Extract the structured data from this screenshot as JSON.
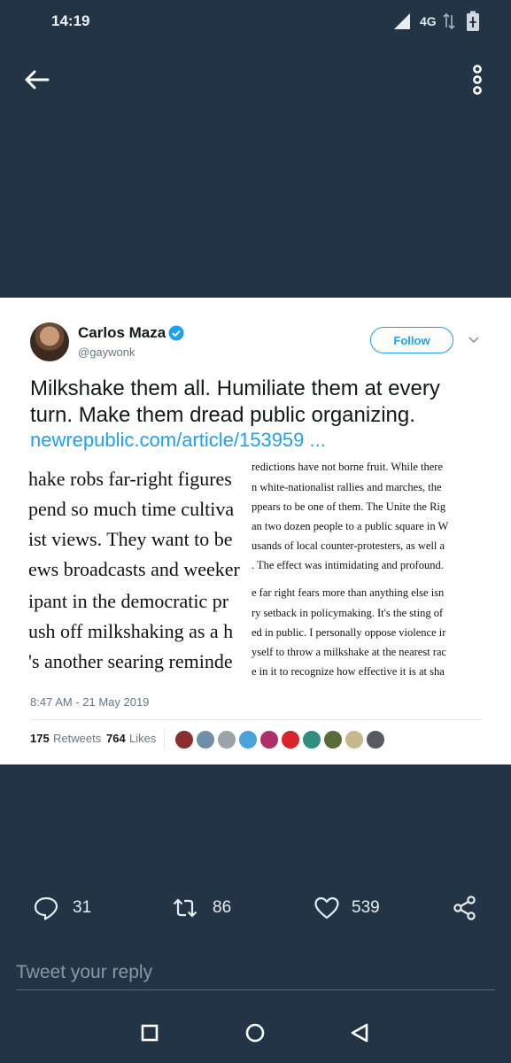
{
  "status_bar": {
    "time": "14:19",
    "network": "4G",
    "icons": [
      "signal-icon",
      "data-arrows-icon",
      "battery-charging-icon"
    ]
  },
  "top_bar": {
    "back_icon": "back-arrow-icon",
    "menu_icon": "overflow-menu-icon"
  },
  "embedded_tweet": {
    "display_name": "Carlos Maza",
    "handle": "@gaywonk",
    "follow_label": "Follow",
    "text_lines": [
      "Milkshake them all. Humiliate them at every",
      "turn. Make them dread public organizing."
    ],
    "link": "newrepublic.com/article/153959 ...",
    "article": {
      "left_lines": [
        "hake robs far-right figures",
        "pend so much time cultiva",
        "ist views. They want to be",
        "ews broadcasts and weeker",
        "ipant in the democratic pr",
        "ush off milkshaking as a h",
        "'s another searing reminde"
      ],
      "right_lines": [
        "redictions have not borne fruit. While there",
        "n white-nationalist rallies and marches, the",
        "ppears to be one of them. The Unite the Rig",
        "an two dozen people to a public square in W",
        "usands of local counter-protesters, as well a",
        ". The effect was intimidating and profound.",
        "e far right fears more than anything else isn",
        "ry setback in policymaking. It's the sting of",
        "ed in public. I personally oppose violence ir",
        "yself to throw a milkshake at the nearest rac",
        "e in it to recognize how effective it is at sha"
      ]
    },
    "timestamp": "8:47 AM - 21 May 2019",
    "retweets_count": "175",
    "retweets_label": "Retweets",
    "likes_count": "764",
    "likes_label": "Likes",
    "colors": {
      "accent": "#1da1f2",
      "text": "#14171a",
      "muted": "#657786"
    }
  },
  "actions": {
    "reply_count": "31",
    "retweet_count": "86",
    "like_count": "539"
  },
  "reply_box": {
    "placeholder": "Tweet your reply"
  },
  "nav_bar": {
    "icons": [
      "recents-square-icon",
      "home-circle-icon",
      "back-triangle-icon"
    ]
  },
  "colors": {
    "background": "#243447",
    "action_text": "#e6ecf0",
    "placeholder": "#8899a6"
  }
}
